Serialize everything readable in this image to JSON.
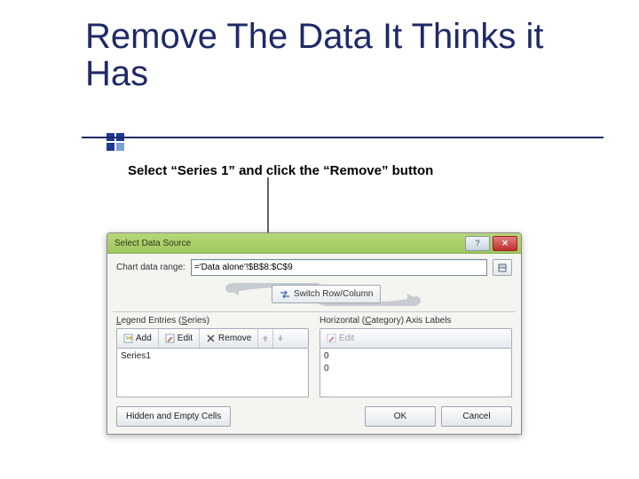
{
  "title": "Remove The Data It Thinks it Has",
  "caption": "Select “Series 1” and click the “Remove” button",
  "dialog": {
    "titlebar": "Select Data Source",
    "help_glyph": "?",
    "close_glyph": "✕",
    "chart_range_label": "Chart data range:",
    "chart_range_value": "='Data alone'!$B$8:$C$9",
    "collapse_tip": "⇲",
    "switch_label": "Switch Row/Column",
    "left_header": "Legend Entries (Series)",
    "right_header": "Horizontal (Category) Axis Labels",
    "buttons": {
      "add": "Add",
      "edit": "Edit",
      "remove": "Remove",
      "edit2": "Edit"
    },
    "series_item": "Series1",
    "cat_item_0": "0",
    "cat_item_1": "0",
    "hidden_btn": "Hidden and Empty Cells",
    "ok": "OK",
    "cancel": "Cancel"
  }
}
